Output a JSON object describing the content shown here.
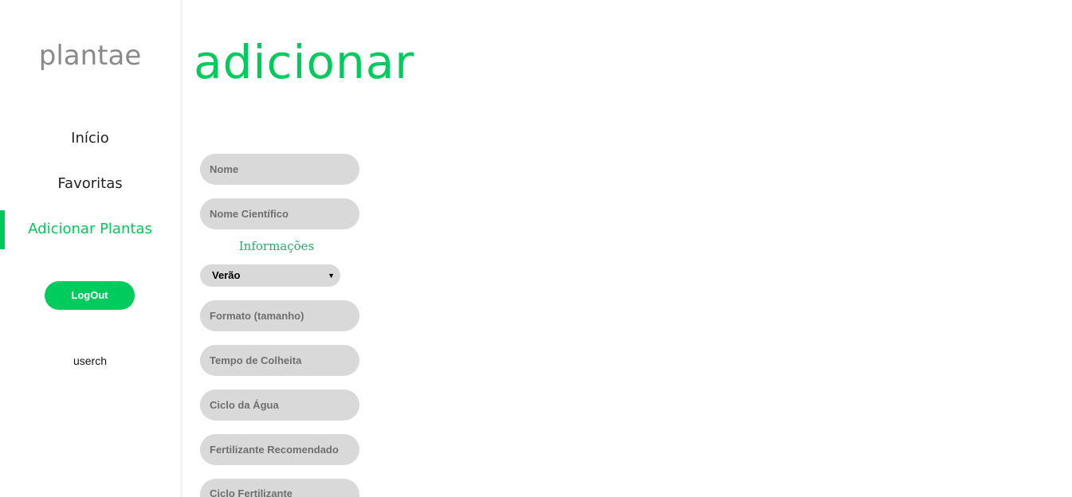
{
  "sidebar": {
    "logo": "plantae",
    "nav": [
      {
        "label": "Início"
      },
      {
        "label": "Favoritas"
      },
      {
        "label": "Adicionar Plantas"
      }
    ],
    "logout_label": "LogOut",
    "username": "userch"
  },
  "main": {
    "title": "adicionar",
    "fields": {
      "nome": {
        "placeholder": "Nome",
        "value": ""
      },
      "nome_cientifico": {
        "placeholder": "Nome Científico",
        "value": ""
      },
      "formato": {
        "placeholder": "Formato (tamanho)",
        "value": ""
      },
      "tempo_colheita": {
        "placeholder": "Tempo de Colheita",
        "value": ""
      },
      "ciclo_agua": {
        "placeholder": "Ciclo da Água",
        "value": ""
      },
      "fertilizante": {
        "placeholder": "Fertilizante Recomendado",
        "value": ""
      },
      "ciclo_fertilizante": {
        "placeholder": "Ciclo Fertilizante",
        "value": ""
      }
    },
    "section_label": "Informações",
    "season_select": {
      "selected": "Verão"
    }
  },
  "colors": {
    "accent": "#00cc5e",
    "field_bg": "#d9d9d9",
    "logo": "#8a8a8a"
  },
  "icons": {
    "select_arrow": "chevron-down-icon"
  }
}
